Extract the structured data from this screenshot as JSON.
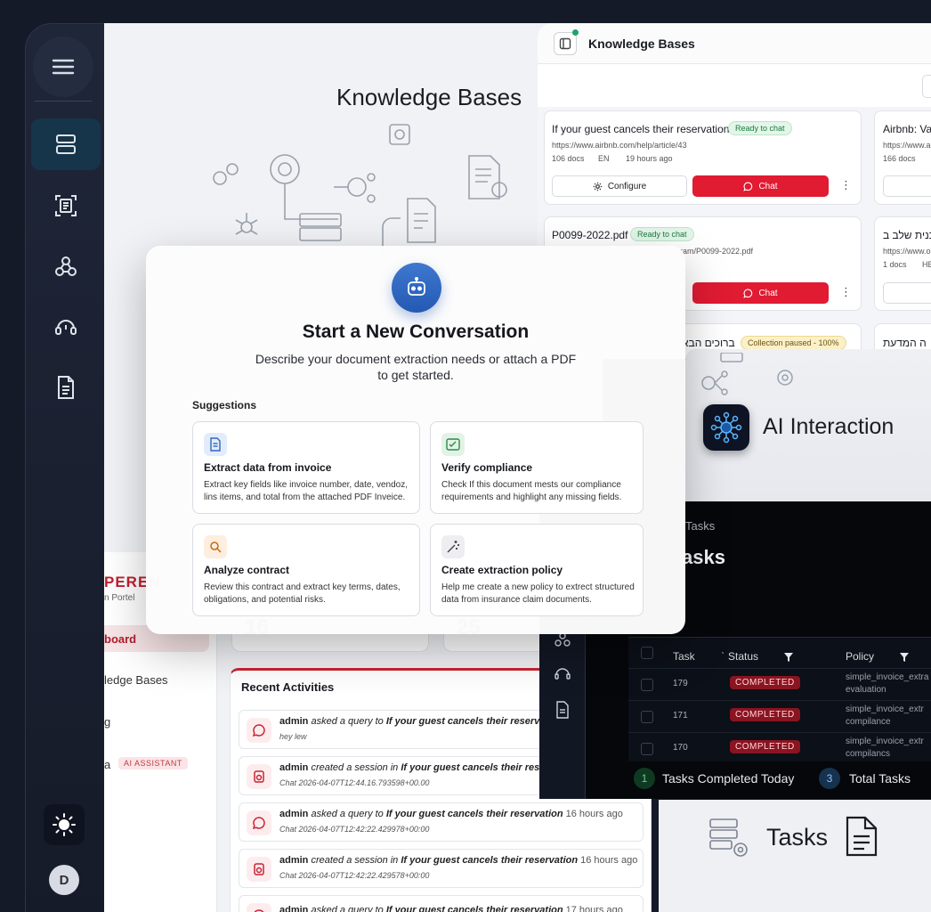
{
  "rail": {
    "items": [
      "menu-icon",
      "layout-icon",
      "scan-document-icon",
      "webhook-icon",
      "support-agent-icon",
      "document-icon"
    ],
    "avatar_initial": "D"
  },
  "background": {
    "title": "Knowledge Bases",
    "brand": "PEREN",
    "brand_sub": "n Portel",
    "side_items": [
      "board",
      "ledge Bases",
      "g",
      "a"
    ],
    "ai_badge": "AI ASSISTANT",
    "stats": [
      "16",
      "25"
    ]
  },
  "recent": {
    "title": "Recent Activities",
    "items": [
      {
        "user": "admin",
        "action": "asked a query to",
        "target": "If your guest cancels their reservation",
        "time": "",
        "sub": "hey lew",
        "icon": "chat-bubble-icon"
      },
      {
        "user": "admin",
        "action": "created a session in",
        "target": "If your guest cancels their reservation",
        "time": "",
        "sub": "Chat 2026-04-07T12:44.16.793598+00.00",
        "icon": "session-icon"
      },
      {
        "user": "admin",
        "action": "asked a query to",
        "target": "If your guest cancels their reservation",
        "time": "16 hours ago",
        "sub": "Chat 2026-04-07T12:42:22.429978+00:00",
        "icon": "chat-bubble-icon"
      },
      {
        "user": "admin",
        "action": "created a session in",
        "target": "If your guest cancels their reservation",
        "time": "16 hours ago",
        "sub": "Chat 2026-04-07T12:42:22.429578+00:00",
        "icon": "session-icon"
      },
      {
        "user": "admin",
        "action": "asked a query to",
        "target": "If your guest cancels their reservation",
        "time": "17 hours ago",
        "sub": "",
        "icon": "chat-bubble-icon"
      }
    ]
  },
  "kb_panel": {
    "title": "Knowledge Bases",
    "cards": [
      {
        "name": "If your guest cancels their reservation",
        "status": "Ready to chat",
        "url": "https://www.airbnb.com/help/article/43",
        "docs": "106 docs",
        "lang": "EN",
        "time": "19 hours ago",
        "configure": "Configure",
        "chat": "Chat"
      },
      {
        "name": "Airbnb: Va",
        "url": "https://www.ai",
        "docs": "166 docs"
      },
      {
        "name": "P0099-2022.pdf",
        "status": "Ready to chat",
        "url": "ram/P0099-2022.pdf",
        "chat": "Chat"
      },
      {
        "name": "תכנית שלב ב",
        "url": "https://www.o",
        "docs": "1 docs",
        "lang": "HE"
      },
      {
        "name": "ברוכים הבא",
        "status": "Collection paused - 100%"
      },
      {
        "name": "ה המדעת"
      }
    ]
  },
  "ai": {
    "title": "AI Interaction"
  },
  "tasks": {
    "crumb": "Tasks",
    "heading": "asks",
    "columns": [
      "Task",
      "Status",
      "Policy"
    ],
    "rows": [
      {
        "id": "179",
        "status": "COMPLETED",
        "policy": [
          "simple_invoice_extra",
          "evaluation"
        ]
      },
      {
        "id": "171",
        "status": "COMPLETED",
        "policy": [
          "simple_invoice_extr",
          "compilance"
        ]
      },
      {
        "id": "170",
        "status": "COMPLETED",
        "policy": [
          "simple_invoice_extr",
          "compilancs"
        ]
      }
    ],
    "completed_today_count": "1",
    "completed_today_label": "Tasks Completed Today",
    "total_count": "3",
    "total_label": "Total Tasks",
    "footer_word": "Tasks"
  },
  "modal": {
    "title": "Start a New Conversation",
    "desc_line1": "Describe your document extraction needs or attach a PDF",
    "desc_line2": "to get started.",
    "suggestions_label": "Suggestions",
    "suggestions": [
      {
        "title": "Extract data from invoice",
        "desc": "Extract key fields like invoice number, date, vendoz, lins items, and total from the attached PDF Inveice.",
        "icon": "invoice-icon",
        "color": "#e3ecfb"
      },
      {
        "title": "Verify compliance",
        "desc": "Check If this document mests our compliance requirements and highlight any missing fields.",
        "icon": "compliance-icon",
        "color": "#e2f3e6"
      },
      {
        "title": "Analyze contract",
        "desc": "Review this contract and extract key terms, dates, obligations, and potential risks.",
        "icon": "search-icon",
        "color": "#fdeee0"
      },
      {
        "title": "Create extraction policy",
        "desc": "Help me create a new policy to extrect structured data from insurance claim documents.",
        "icon": "magic-wand-icon",
        "color": "#eeeef2"
      }
    ]
  }
}
